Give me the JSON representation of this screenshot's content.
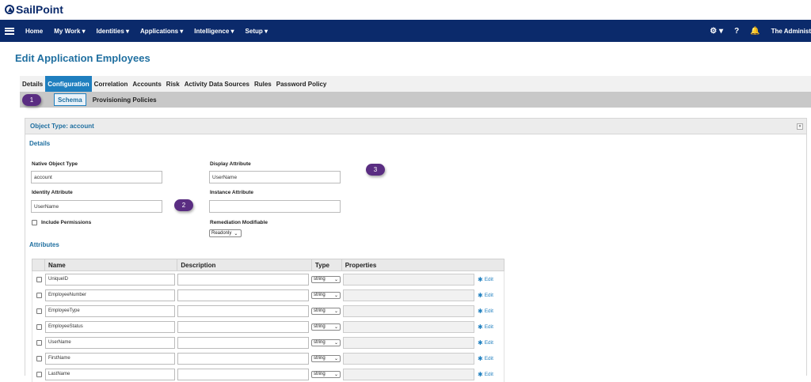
{
  "brand": {
    "name": "SailPoint"
  },
  "nav": {
    "items": [
      "Home",
      "My Work ▾",
      "Identities ▾",
      "Applications ▾",
      "Intelligence ▾",
      "Setup ▾"
    ],
    "settings_label": "⚙ ▾",
    "help_label": "?",
    "bell_label": "🔔",
    "user": "The Administ"
  },
  "page": {
    "title": "Edit Application Employees"
  },
  "tabs": [
    "Details",
    "Configuration",
    "Correlation",
    "Accounts",
    "Risk",
    "Activity Data Sources",
    "Rules",
    "Password Policy"
  ],
  "active_tab": "Configuration",
  "subtabs": [
    "Schema",
    "Provisioning Policies"
  ],
  "active_subtab": "Schema",
  "callouts": [
    "1",
    "2",
    "3"
  ],
  "panel": {
    "header": "Object Type: account",
    "collapse_label": "«",
    "details_title": "Details",
    "native_object_type_label": "Native Object Type",
    "native_object_type_value": "account",
    "display_attribute_label": "Display Attribute",
    "display_attribute_value": "UserName",
    "identity_attribute_label": "Identity Attribute",
    "identity_attribute_value": "UserName",
    "instance_attribute_label": "Instance Attribute",
    "instance_attribute_value": "",
    "include_permissions_label": "Include Permissions",
    "remediation_modifiable_label": "Remediation Modifiable",
    "remediation_modifiable_value": "Readonly",
    "attributes_title": "Attributes"
  },
  "table": {
    "headers": [
      "Name",
      "Description",
      "Type",
      "Properties"
    ],
    "rows": [
      {
        "name": "UniqueID",
        "description": "",
        "type": "string",
        "edit": "Edit"
      },
      {
        "name": "EmployeeNumber",
        "description": "",
        "type": "string",
        "edit": "Edit"
      },
      {
        "name": "EmployeeType",
        "description": "",
        "type": "string",
        "edit": "Edit"
      },
      {
        "name": "EmployeeStatus",
        "description": "",
        "type": "string",
        "edit": "Edit"
      },
      {
        "name": "UserName",
        "description": "",
        "type": "string",
        "edit": "Edit"
      },
      {
        "name": "FirstName",
        "description": "",
        "type": "string",
        "edit": "Edit"
      },
      {
        "name": "LastName",
        "description": "",
        "type": "string",
        "edit": "Edit"
      }
    ]
  },
  "colors": {
    "nav_bg": "#0b2a6b",
    "accent": "#1f7fbf",
    "title": "#1f6fa0",
    "callout": "#5a2d82"
  }
}
